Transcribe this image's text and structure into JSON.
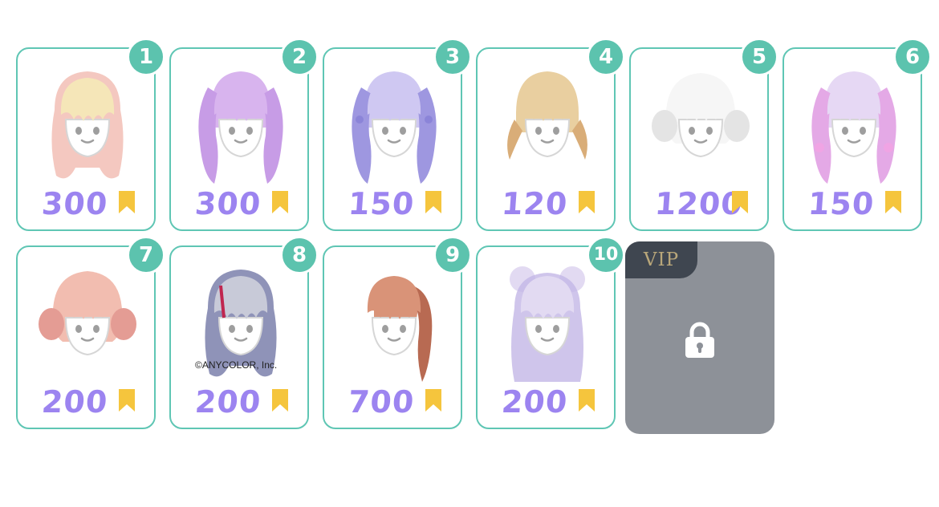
{
  "items": [
    {
      "number": "1",
      "price": "300",
      "hair": {
        "main": "#f5e6b8",
        "tip": "#f4c8c0",
        "style": "long-curl"
      }
    },
    {
      "number": "2",
      "price": "300",
      "hair": {
        "main": "#d8b4ee",
        "tip": "#c79ce6",
        "style": "twin-tails"
      }
    },
    {
      "number": "3",
      "price": "150",
      "hair": {
        "main": "#cfc8f2",
        "tip": "#9e97e0",
        "style": "braids"
      }
    },
    {
      "number": "4",
      "price": "120",
      "hair": {
        "main": "#e9cfa0",
        "tip": "#d9ad78",
        "style": "short-pigtails"
      }
    },
    {
      "number": "5",
      "price": "1200",
      "hair": {
        "main": "#f6f6f6",
        "tip": "#e4e4e4",
        "style": "bob"
      }
    },
    {
      "number": "6",
      "price": "150",
      "hair": {
        "main": "#e6d8f4",
        "tip": "#e4a9e6",
        "style": "ribbon-twins"
      }
    },
    {
      "number": "7",
      "price": "200",
      "hair": {
        "main": "#f2bdb0",
        "tip": "#e49c94",
        "style": "short-buns"
      }
    },
    {
      "number": "8",
      "price": "200",
      "hair": {
        "main": "#c8cad8",
        "tip": "#8f93b8",
        "style": "wavy"
      },
      "copyright": "©ANYCOLOR, Inc."
    },
    {
      "number": "9",
      "price": "700",
      "hair": {
        "main": "#d99378",
        "tip": "#b86a52",
        "style": "ponytail"
      }
    },
    {
      "number": "10",
      "price": "200",
      "hair": {
        "main": "#e2daf2",
        "tip": "#c3b6e6",
        "style": "space-buns"
      }
    }
  ],
  "vip": {
    "label": "VIP",
    "icon": "lock-icon"
  },
  "colors": {
    "border": "#5fc6b4",
    "badge": "#5cc3ae",
    "price": "#9c84f0",
    "bookmark": "#f5c53d",
    "vip_bg": "#8d9198"
  },
  "currency_icon": "bookmark-icon"
}
